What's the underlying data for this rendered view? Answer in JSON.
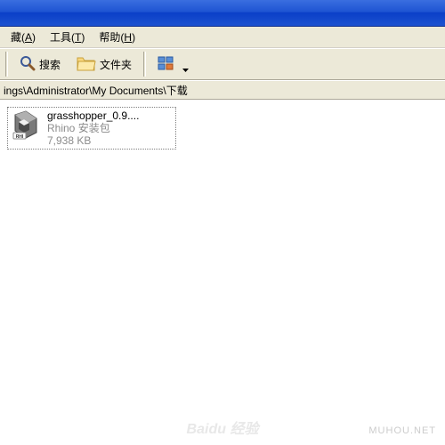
{
  "menu": {
    "favorites": {
      "label": "藏",
      "mnemonic": "A"
    },
    "tools": {
      "label": "工具",
      "mnemonic": "T"
    },
    "help": {
      "label": "帮助",
      "mnemonic": "H"
    }
  },
  "toolbar": {
    "search_label": "搜索",
    "folders_label": "文件夹"
  },
  "address": {
    "path": "ings\\Administrator\\My Documents\\下载"
  },
  "file": {
    "name": "grasshopper_0.9....",
    "type": "Rhino 安装包",
    "size": "7,938 KB"
  },
  "watermark": "MUHOU.NET",
  "watermark2": "Baidu 经验"
}
